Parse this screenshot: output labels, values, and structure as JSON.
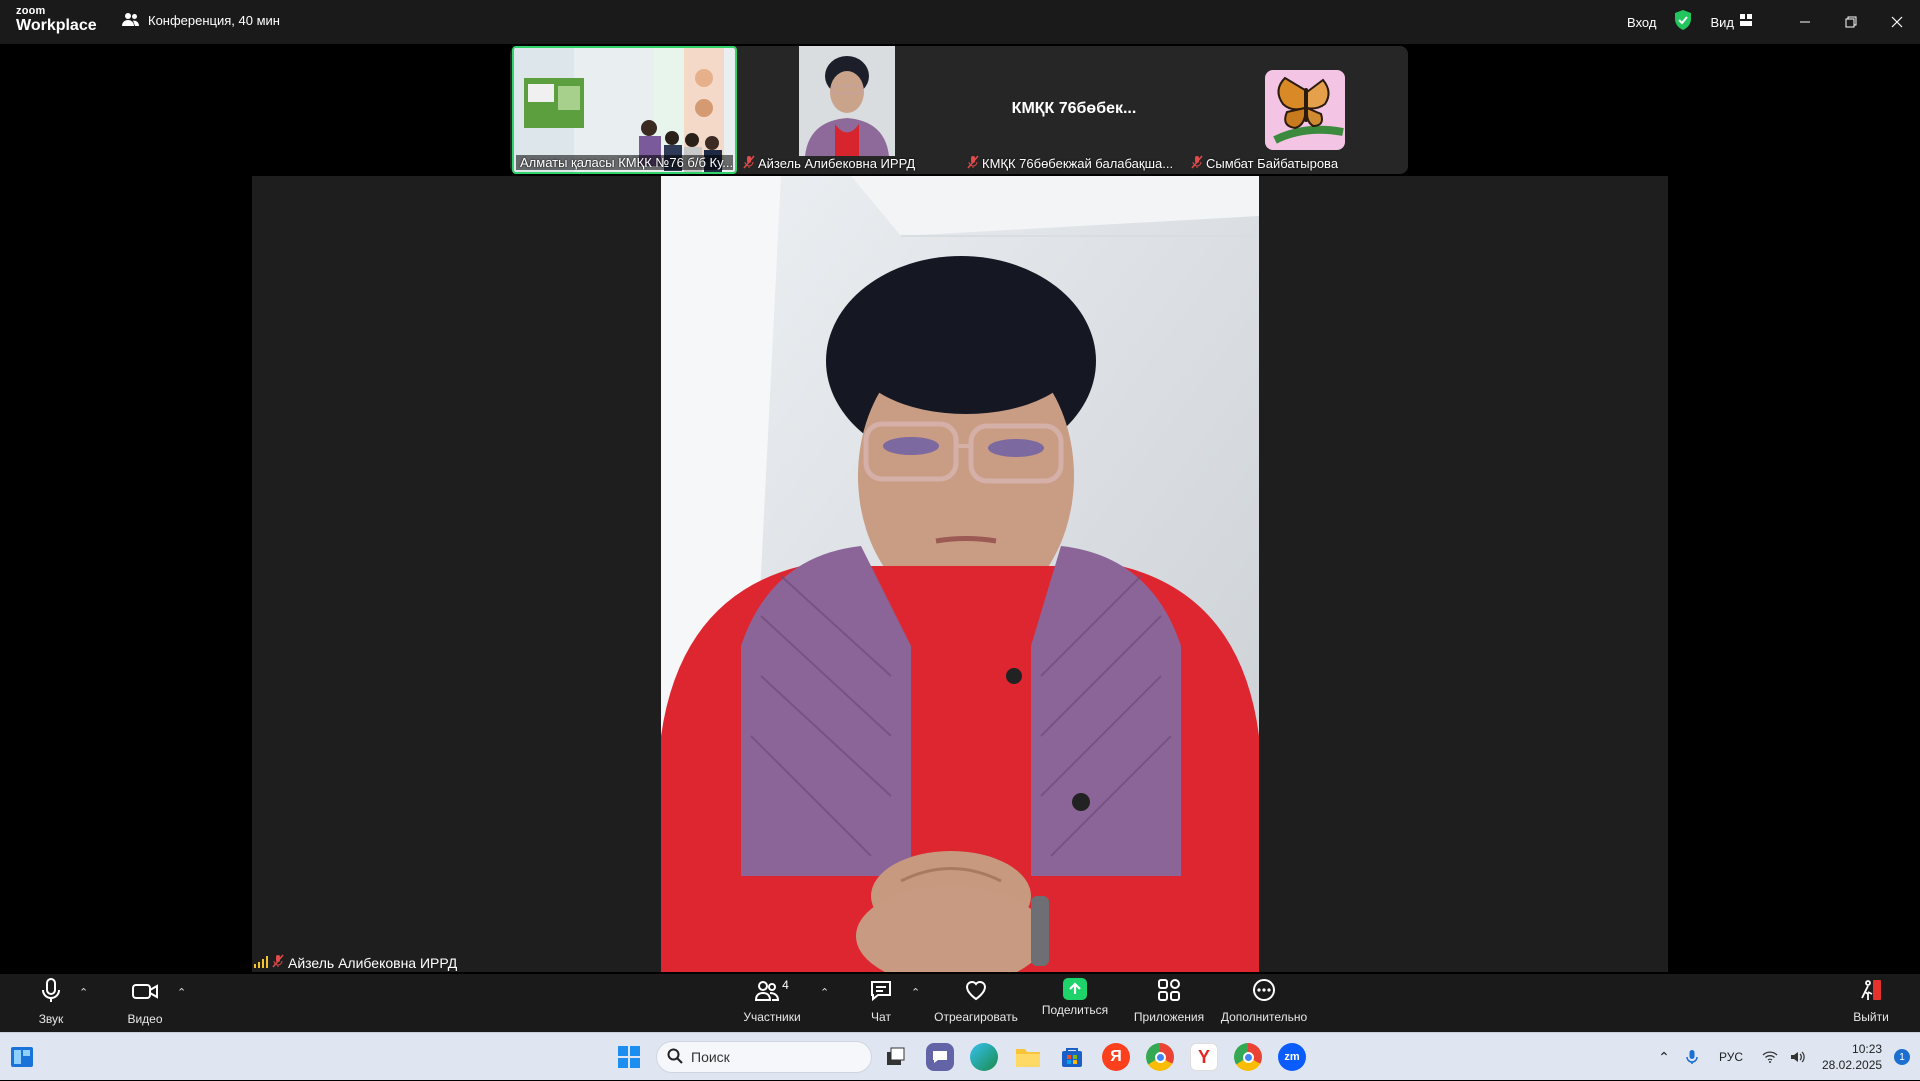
{
  "app": {
    "logo_line1": "zoom",
    "logo_line2": "Workplace",
    "meeting_title": "Конференция, 40 мин"
  },
  "topbar": {
    "signin": "Вход",
    "view": "Вид"
  },
  "gallery": [
    {
      "name": "Алматы қаласы КМҚК №76 б/б Ку...",
      "muted": false,
      "active": true
    },
    {
      "name": "Айзель Алибековна ИРРД",
      "muted": true,
      "active": false
    },
    {
      "name": "КМҚК 76бөбекжай балабақша...",
      "muted": true,
      "active": false,
      "big_name": "КМҚК 76бөбек..."
    },
    {
      "name": "Сымбат Байбатырова",
      "muted": true,
      "active": false
    }
  ],
  "main_speaker": {
    "name": "Айзель Алибековна ИРРД",
    "muted": true
  },
  "toolbar": {
    "audio": "Звук",
    "video": "Видео",
    "participants": "Участники",
    "participants_count": "4",
    "chat": "Чат",
    "react": "Отреагировать",
    "share": "Поделиться",
    "apps": "Приложения",
    "more": "Дополнительно",
    "leave": "Выйти"
  },
  "taskbar": {
    "search_placeholder": "Поиск",
    "lang": "РУС",
    "time": "10:23",
    "date": "28.02.2025",
    "notif_count": "1"
  },
  "colors": {
    "accent_green": "#32d36b",
    "share_green": "#1fd36b",
    "leave_red": "#e5322d",
    "muted_red": "#e24b4b"
  }
}
